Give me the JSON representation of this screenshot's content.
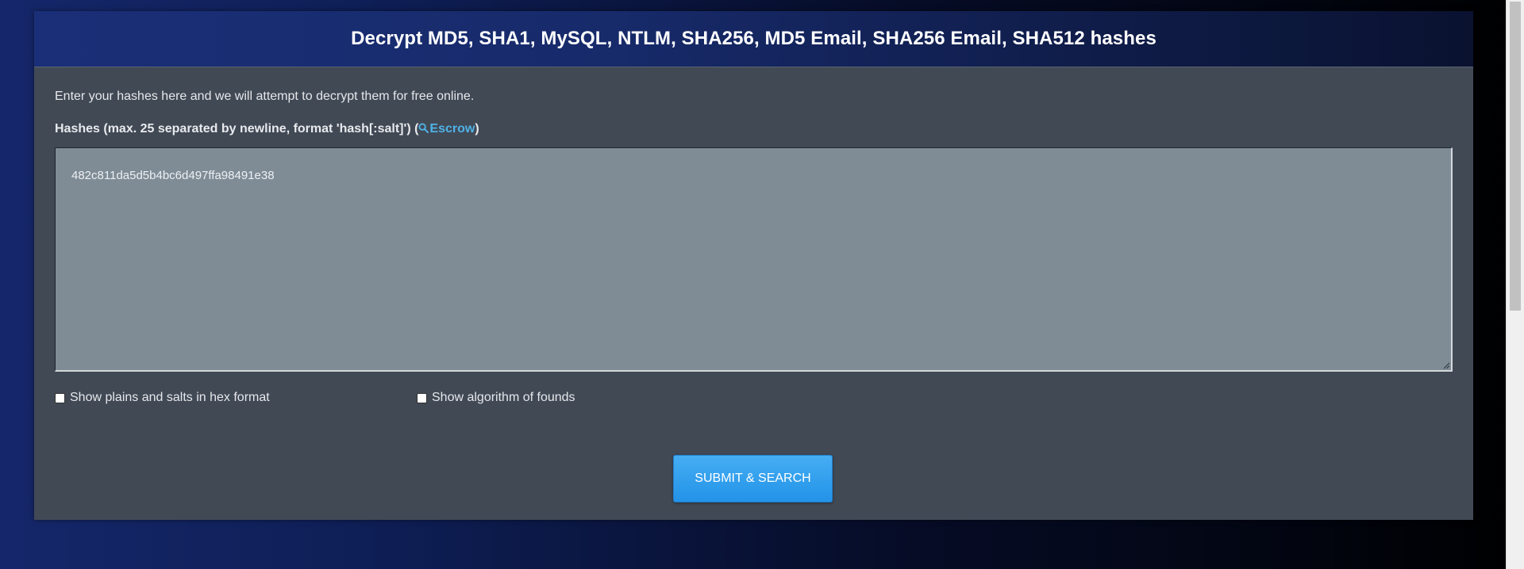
{
  "panel": {
    "title": "Decrypt MD5, SHA1, MySQL, NTLM, SHA256, MD5 Email, SHA256 Email, SHA512 hashes",
    "intro": "Enter your hashes here and we will attempt to decrypt them for free online.",
    "hash_label_prefix": "Hashes (max. 25 separated by newline, format 'hash[:salt]') (",
    "escrow_label": "Escrow",
    "hash_label_suffix": ")"
  },
  "hash_input": {
    "value": "482c811da5d5b4bc6d497ffa98491e38"
  },
  "options": [
    {
      "label": "Show plains and salts in hex format",
      "checked": false
    },
    {
      "label": "Show algorithm of founds",
      "checked": false
    }
  ],
  "submit": {
    "label": "SUBMIT & SEARCH"
  },
  "colors": {
    "panel_bg": "#414955",
    "header_bg": "#1a2f78",
    "textarea_bg": "#7f8c96",
    "link": "#4fb2e6",
    "button": "#2393e8"
  },
  "icons": {
    "escrow": "search-icon"
  }
}
